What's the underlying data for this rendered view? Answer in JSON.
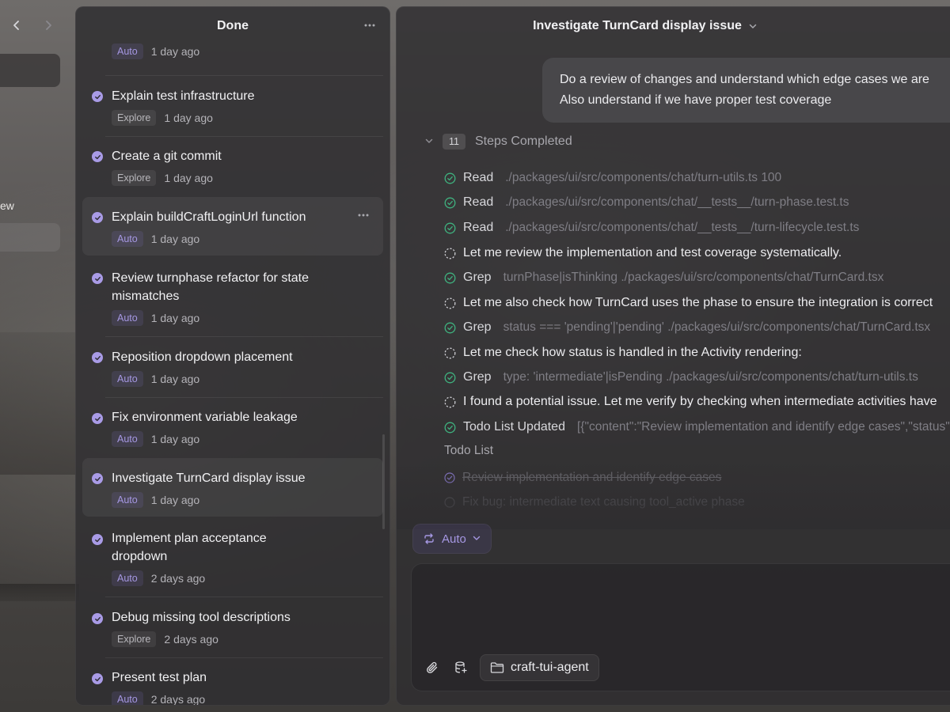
{
  "left_strip": {
    "partial_label": "ew"
  },
  "session_list": {
    "title": "Done",
    "items": [
      {
        "title": "",
        "badge": "Auto",
        "time": "1 day ago"
      },
      {
        "title": "Explain test infrastructure",
        "badge": "Explore",
        "time": "1 day ago"
      },
      {
        "title": "Create a git commit",
        "badge": "Explore",
        "time": "1 day ago"
      },
      {
        "title": "Explain buildCraftLoginUrl function",
        "badge": "Auto",
        "time": "1 day ago"
      },
      {
        "title": "Review turnphase refactor for state mismatches",
        "badge": "Auto",
        "time": "1 day ago"
      },
      {
        "title": "Reposition dropdown placement",
        "badge": "Auto",
        "time": "1 day ago"
      },
      {
        "title": "Fix environment variable leakage",
        "badge": "Auto",
        "time": "1 day ago"
      },
      {
        "title": "Investigate TurnCard display issue",
        "badge": "Auto",
        "time": "1 day ago"
      },
      {
        "title": "Implement plan acceptance dropdown",
        "badge": "Auto",
        "time": "2 days ago"
      },
      {
        "title": "Debug missing tool descriptions",
        "badge": "Explore",
        "time": "2 days ago"
      },
      {
        "title": "Present test plan",
        "badge": "Auto",
        "time": "2 days ago"
      }
    ]
  },
  "chat": {
    "title": "Investigate TurnCard display issue",
    "user_message": {
      "line1": "Do a review of changes and understand which edge cases we are",
      "line2": "Also understand if we have proper test coverage"
    },
    "steps_count": "11",
    "steps_label": "Steps Completed",
    "steps": [
      {
        "kind": "tool",
        "verb": "Read",
        "arg": "./packages/ui/src/components/chat/turn-utils.ts 100"
      },
      {
        "kind": "tool",
        "verb": "Read",
        "arg": "./packages/ui/src/components/chat/__tests__/turn-phase.test.ts"
      },
      {
        "kind": "tool",
        "verb": "Read",
        "arg": "./packages/ui/src/components/chat/__tests__/turn-lifecycle.test.ts"
      },
      {
        "kind": "thought",
        "text": "Let me review the implementation and test coverage systematically."
      },
      {
        "kind": "tool",
        "verb": "Grep",
        "arg": "turnPhase|isThinking ./packages/ui/src/components/chat/TurnCard.tsx"
      },
      {
        "kind": "thought",
        "text": "Let me also check how TurnCard uses the phase to ensure the integration is correct"
      },
      {
        "kind": "tool",
        "verb": "Grep",
        "arg": "status === 'pending'|'pending' ./packages/ui/src/components/chat/TurnCard.tsx"
      },
      {
        "kind": "thought",
        "text": "Let me check how status is handled in the Activity rendering:"
      },
      {
        "kind": "tool",
        "verb": "Grep",
        "arg": "type: 'intermediate'|isPending ./packages/ui/src/components/chat/turn-utils.ts"
      },
      {
        "kind": "thought",
        "text": "I found a potential issue. Let me verify by checking when intermediate activities have"
      },
      {
        "kind": "tool",
        "verb": "Todo List Updated",
        "arg": "[{\"content\":\"Review implementation and identify edge cases\",\"status\""
      }
    ],
    "todo_title": "Todo List",
    "todos": [
      {
        "text": "Review implementation and identify edge cases",
        "done": true
      },
      {
        "text": "Fix bug: intermediate text causing tool_active phase",
        "done": false
      }
    ],
    "mode_label": "Auto",
    "composer": {
      "placeholder": "",
      "folder_label": "craft-tui-agent"
    }
  },
  "colors": {
    "accent": "#a597e2",
    "success": "#3fb27f"
  }
}
